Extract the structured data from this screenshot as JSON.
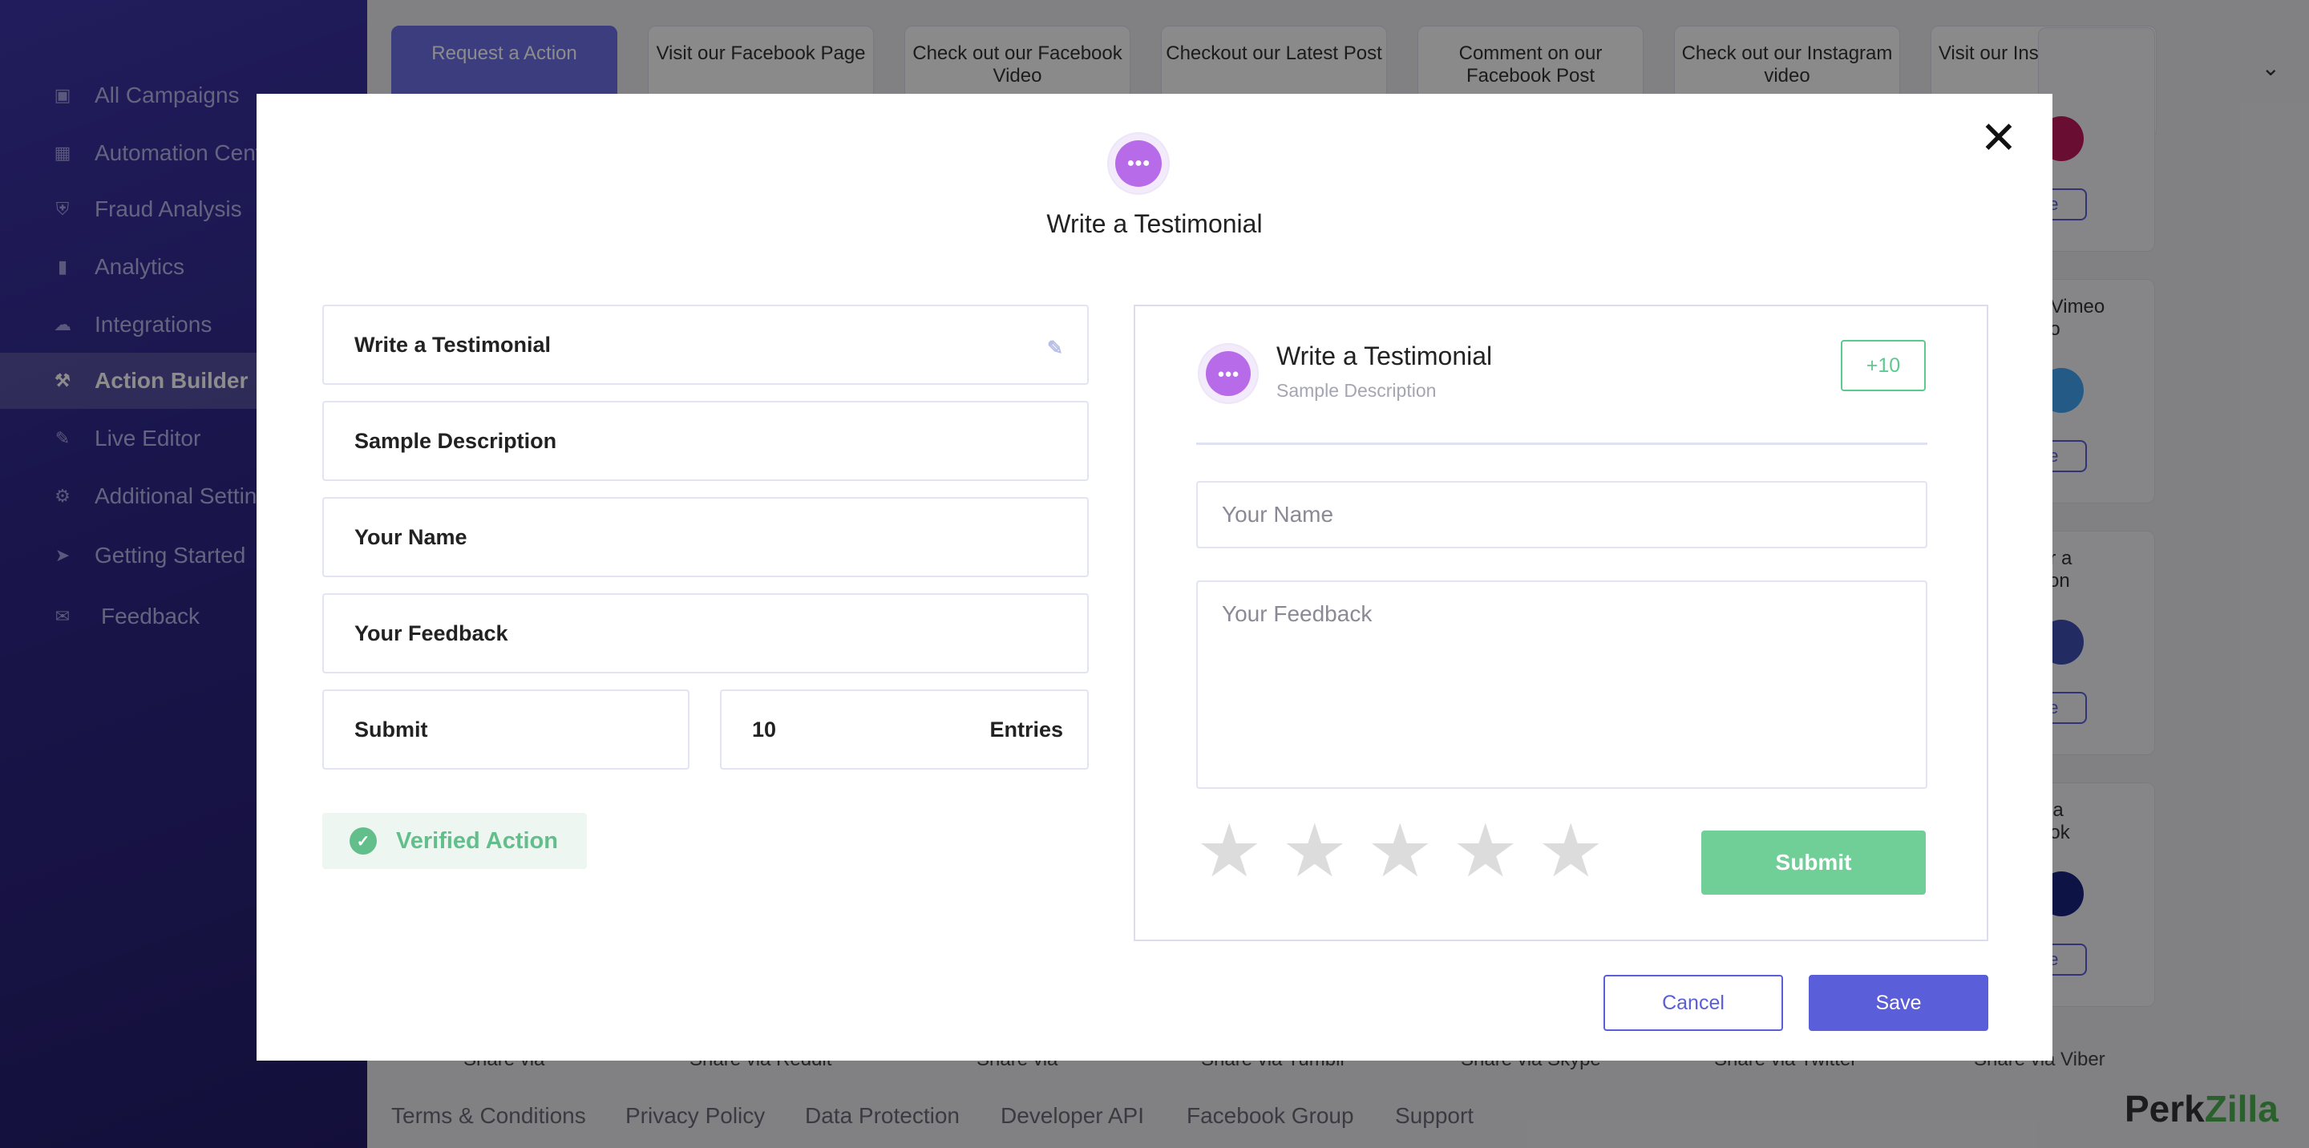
{
  "sidebar": {
    "items": [
      {
        "label": "All Campaigns",
        "icon": "box-icon"
      },
      {
        "label": "Automation Center",
        "icon": "robot-icon"
      },
      {
        "label": "Fraud Analysis",
        "icon": "shield-icon"
      },
      {
        "label": "Analytics",
        "icon": "bar-chart-icon"
      },
      {
        "label": "Integrations",
        "icon": "cloud-icon"
      },
      {
        "label": "Action Builder",
        "icon": "hammer-icon",
        "active": true
      },
      {
        "label": "Live Editor",
        "icon": "edit-icon"
      },
      {
        "label": "Additional Settings",
        "icon": "gear-icon"
      },
      {
        "label": "Getting Started",
        "icon": "runner-icon"
      },
      {
        "label": "Feedback",
        "icon": "chat-icon"
      }
    ]
  },
  "action_tabs": [
    "Request a Action",
    "Visit our Facebook Page",
    "Check out our Facebook Video",
    "Checkout our Latest Post",
    "Comment on our Facebook Post",
    "Check out our Instagram video",
    "Visit our Instagram Page"
  ],
  "bg_cards": [
    {
      "text": "",
      "pill": "de"
    },
    {
      "text": "r Vimeo\neo",
      "pill": "de"
    },
    {
      "text": "er a\ntion",
      "pill": "de"
    },
    {
      "text": "via\nook",
      "pill": "de"
    }
  ],
  "share_row": [
    "Share via",
    "Share via Reddit",
    "Share via",
    "Share via Tumblr",
    "Share via Skype",
    "Share via Twitter",
    "Share via Viber"
  ],
  "footer": {
    "links": [
      "Terms & Conditions",
      "Privacy Policy",
      "Data Protection",
      "Developer API",
      "Facebook Group",
      "Support"
    ],
    "brand_a": "Perk",
    "brand_b": "Zilla"
  },
  "modal": {
    "title": "Write a Testimonial",
    "fields": {
      "title": "Write a Testimonial",
      "description": "Sample Description",
      "name": "Your Name",
      "feedback": "Your Feedback",
      "submit": "Submit",
      "entries_value": "10",
      "entries_label": "Entries"
    },
    "verified_label": "Verified Action",
    "preview": {
      "title": "Write a Testimonial",
      "description": "Sample Description",
      "points": "+10",
      "name_placeholder": "Your Name",
      "feedback_placeholder": "Your Feedback",
      "rating_max": 5,
      "submit_label": "Submit"
    },
    "cancel_label": "Cancel",
    "save_label": "Save"
  },
  "colors": {
    "primary": "#5a5ed8",
    "success": "#6fcf97",
    "icon_purple": "#b86be8",
    "sidebar": "#2f2788"
  }
}
